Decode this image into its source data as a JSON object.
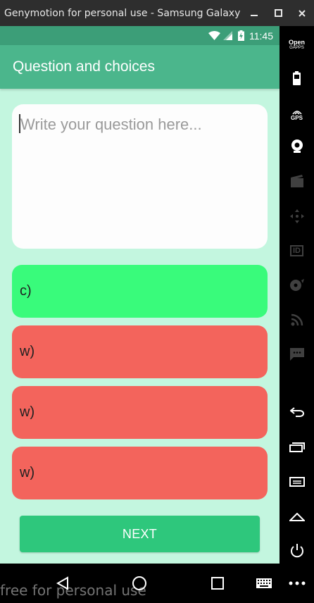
{
  "window": {
    "title": "Genymotion for personal use - Samsung Galaxy ..."
  },
  "statusbar": {
    "time": "11:45"
  },
  "appbar": {
    "title": "Question and choices"
  },
  "question": {
    "placeholder": "Write your question here...",
    "value": ""
  },
  "choices": [
    {
      "label": "c)",
      "kind": "correct",
      "color": "#39fb7b"
    },
    {
      "label": "w)",
      "kind": "wrong",
      "color": "#f3645c"
    },
    {
      "label": "w)",
      "kind": "wrong",
      "color": "#f3645c"
    },
    {
      "label": "w)",
      "kind": "wrong",
      "color": "#f3645c"
    }
  ],
  "next_button": {
    "label": "NEXT"
  },
  "sidebar": {
    "open_gapps": "Open",
    "gapps_sub": "GAPPS",
    "gps": "GPS",
    "id": "ID",
    "items": [
      "open-gapps-icon",
      "battery-icon",
      "gps-icon",
      "webcam-icon",
      "media-icon",
      "dpad-icon",
      "id-icon",
      "disk-icon",
      "network-icon",
      "sms-icon",
      "back-icon",
      "recent-apps-icon",
      "menu-icon",
      "home-icon",
      "power-icon"
    ]
  },
  "watermark": "free for personal use",
  "colors": {
    "primary": "#4bb68c",
    "primary_dark": "#3c9e78",
    "background": "#c3f6df",
    "button": "#2ec77c"
  }
}
